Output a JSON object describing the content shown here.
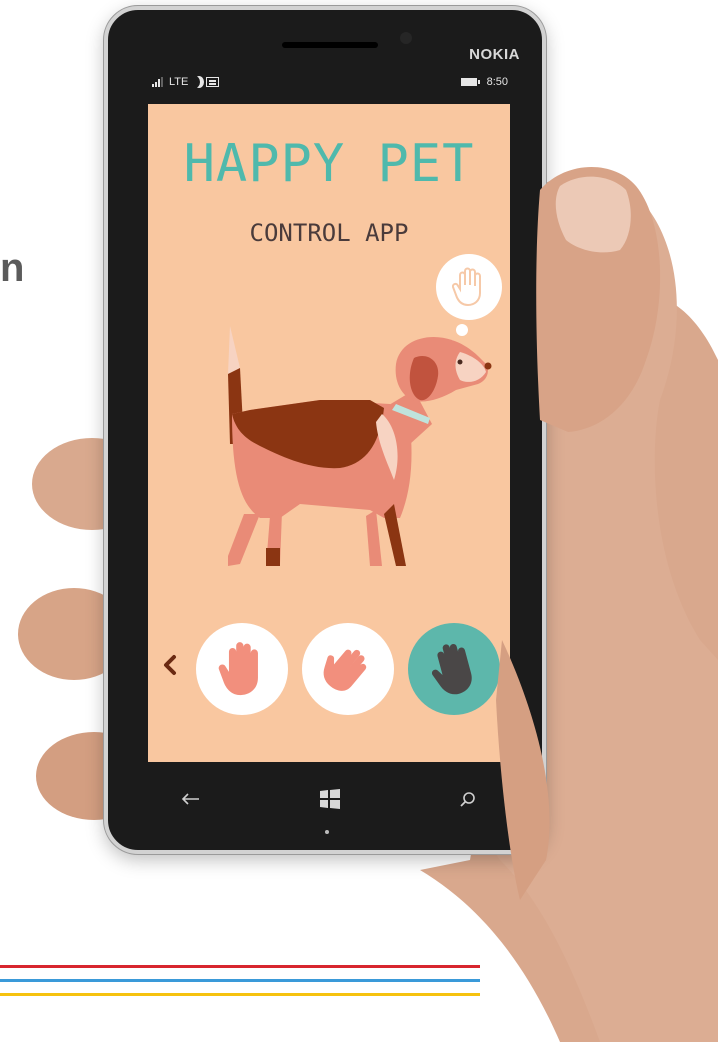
{
  "background_fragment": "n",
  "phone": {
    "brand": "NOKIA",
    "status": {
      "network": "LTE",
      "time": "8:50"
    }
  },
  "app": {
    "title": "HAPPY PET",
    "subtitle": "CONTROL APP",
    "thought_icon": "hand-stop-icon",
    "controls": [
      {
        "name": "hand-stop",
        "bg": "#ffffff",
        "fg": "#f28f7d"
      },
      {
        "name": "hand-pet",
        "bg": "#ffffff",
        "fg": "#f28f7d"
      },
      {
        "name": "hand-paw",
        "bg": "#5db7ab",
        "fg": "#4a4747"
      }
    ]
  },
  "colors": {
    "screen": "#f9c7a0",
    "title": "#4fb9ac",
    "subtitle": "#4a3b3b",
    "dog_body": "#e98b77",
    "dog_dark": "#8b3512",
    "dog_light": "#f7d3c2",
    "stripes": [
      "#d8262e",
      "#3a9ad9",
      "#f6c20f"
    ]
  }
}
